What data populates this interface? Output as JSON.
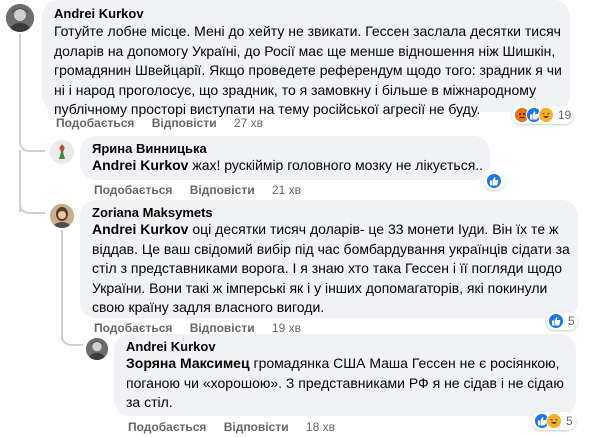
{
  "comments": [
    {
      "author": "Andrei Kurkov",
      "lines": [
        "Готуйте лобне місце. Мені до хейту не звикати. Гессен заслала десятки тисяч",
        "доларів на допомогу Україні, до Росії має ще менше відношення ніж Шишкін,",
        "громадянин Швейцарії. Якщо проведете референдум щодо того: зрадник я чи",
        "ні і народ проголосує, що зрадник, то я замовкну і більше в міжнародному",
        "публічному просторі виступати на тему російської агресії не буду."
      ],
      "like_label": "Подобається",
      "reply_label": "Відповісти",
      "time": "27 хв",
      "reactions": [
        "angry",
        "like",
        "haha"
      ],
      "reaction_count": "19"
    },
    {
      "author": "Ярина Винницька",
      "mention": "Andrei Kurkov",
      "lines_after_mention": [
        " жах! рускіймір головного мозку не лікується.."
      ],
      "like_label": "Подобається",
      "reply_label": "Відповісти",
      "time": "21 хв",
      "reactions": [
        "like"
      ],
      "reaction_count": ""
    },
    {
      "author": "Zoriana Maksymets",
      "mention": "Andrei Kurkov",
      "first_line_rest": " оці десятки тисяч доларів- це 33 монети Іуди. Він їх те ж",
      "lines": [
        "віддав. Це ваш свідомий вибір під час бомбардування українців сідати за",
        "стіл з представниками ворога. І я знаю хто така Гессен і її погляди щодо",
        "України. Вони такі ж імперські як і у інших допомагаторів, які покинули",
        "свою країну задля власного вигоди."
      ],
      "like_label": "Подобається",
      "reply_label": "Відповісти",
      "time": "19 хв",
      "reactions": [
        "like"
      ],
      "reaction_count": "5"
    },
    {
      "author": "Andrei Kurkov",
      "mention": "Зоряна Максимец",
      "first_line_rest": " громадянка США Маша Гессен не є росіянкою,",
      "lines": [
        "поганою чи «хорошою». З представниками РФ я не сідав і не сідаю",
        "за стіл."
      ],
      "like_label": "Подобається",
      "reply_label": "Відповісти",
      "time": "18 хв",
      "reactions": [
        "like",
        "haha"
      ],
      "reaction_count": "5"
    }
  ],
  "colors": {
    "bubble": "#f0f2f5",
    "meta": "#65676b",
    "like_blue": "#1877f2",
    "angry": "#e9710f",
    "haha_yellow": "#f7b125"
  }
}
